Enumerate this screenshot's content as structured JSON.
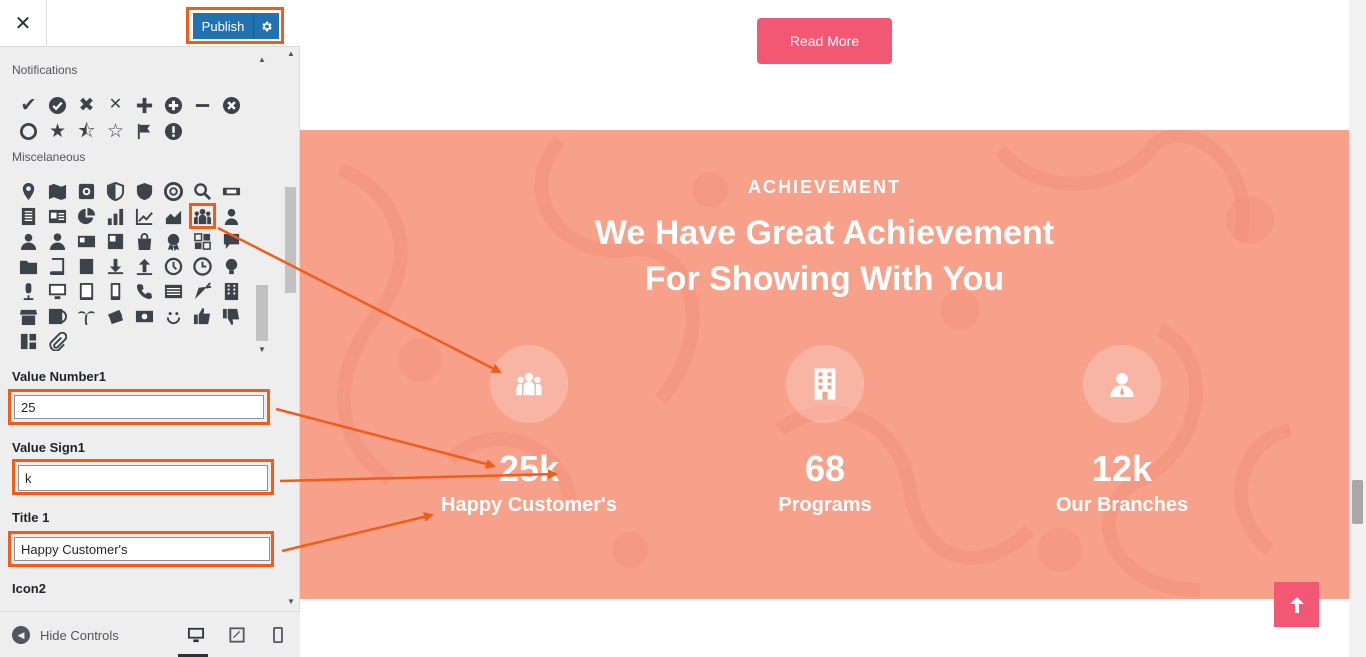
{
  "sidebar": {
    "publish_label": "Publish",
    "notifications_label": "Notifications",
    "misc_label": "Miscelaneous",
    "fields": {
      "value_number1": {
        "label": "Value Number1",
        "value": "25"
      },
      "value_sign1": {
        "label": "Value Sign1",
        "value": "k"
      },
      "title1": {
        "label": "Title 1",
        "value": "Happy Customer's"
      },
      "icon2": {
        "label": "Icon2"
      }
    },
    "footer": {
      "hide_controls": "Hide Controls"
    }
  },
  "preview": {
    "read_more": "Read More",
    "eyebrow": "ACHIEVEMENT",
    "headline_line1": "We Have Great Achievement",
    "headline_line2": "For Showing With You",
    "stats": [
      {
        "number": "25k",
        "title": "Happy Customer's",
        "icon": "users-icon"
      },
      {
        "number": "68",
        "title": "Programs",
        "icon": "building-icon"
      },
      {
        "number": "12k",
        "title": "Our Branches",
        "icon": "user-icon"
      }
    ]
  },
  "colors": {
    "accent": "#f25773",
    "highlight": "#f25c1b",
    "section_bg": "#f7a18a",
    "publish": "#2271b1"
  }
}
